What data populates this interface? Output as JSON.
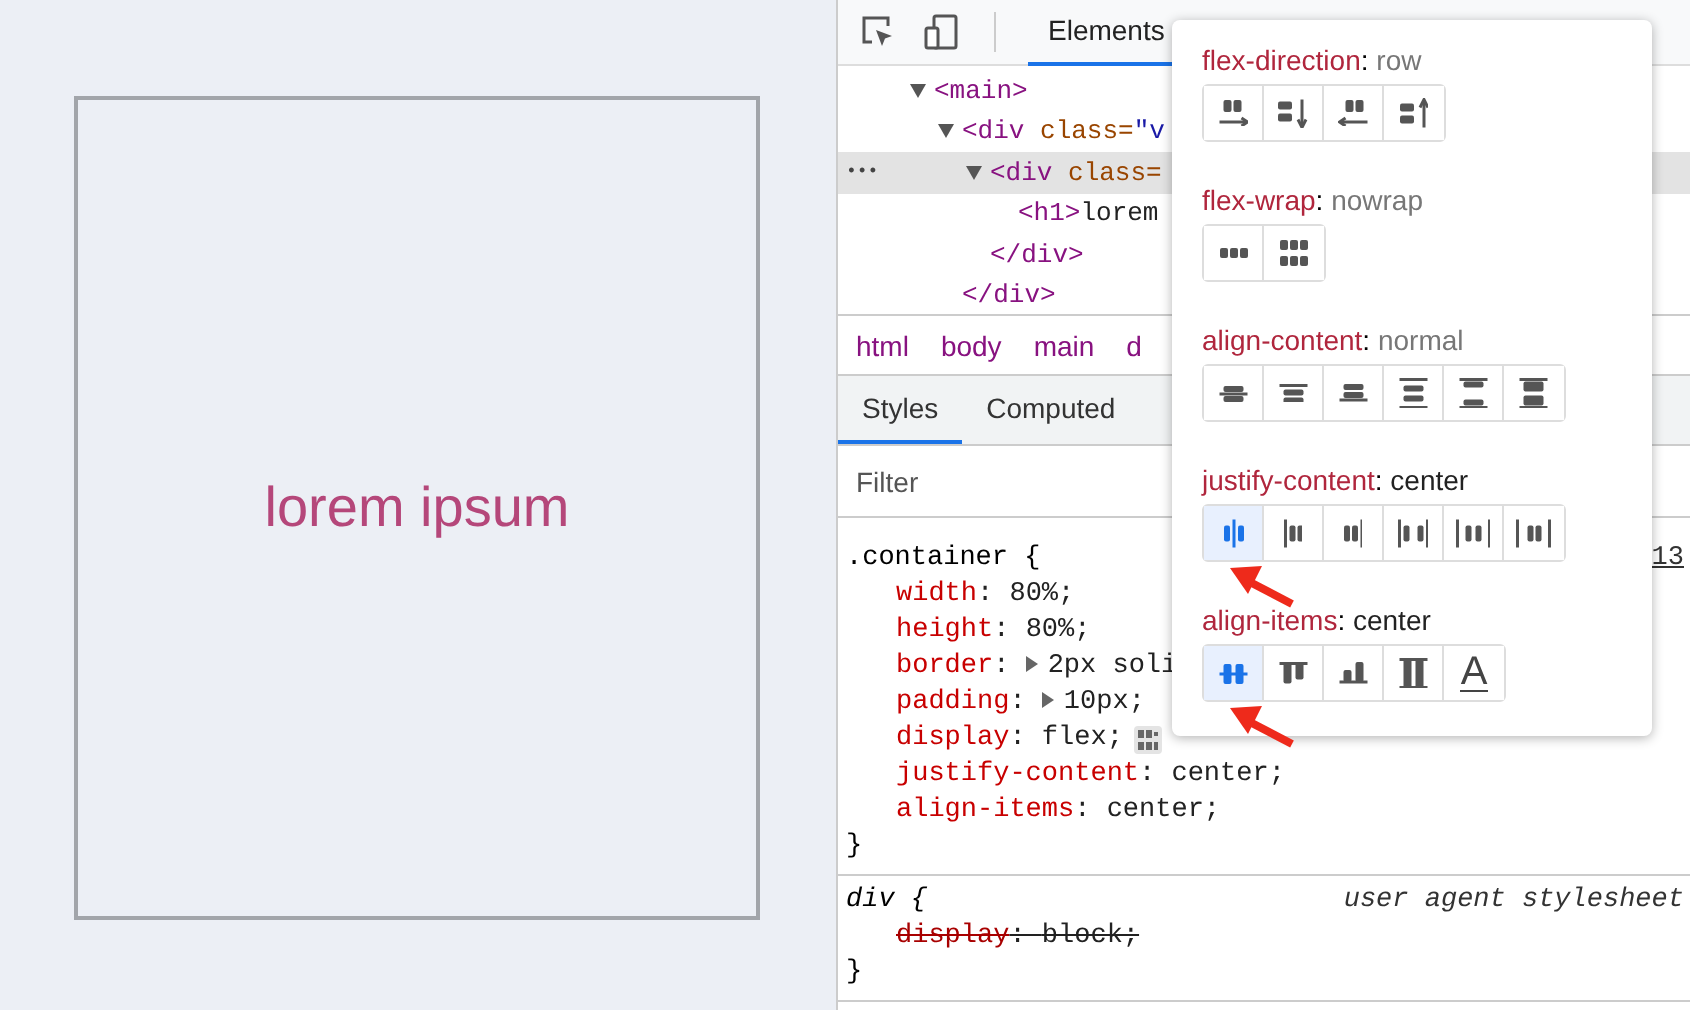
{
  "page": {
    "heading": "lorem ipsum"
  },
  "devtools": {
    "toolbar": {
      "tabs": [
        {
          "label": "Elements",
          "selected": true
        }
      ]
    },
    "elements_tree": [
      {
        "parts": [
          {
            "kind": "tag",
            "text": "<main>"
          }
        ],
        "expanded": true,
        "selected": false,
        "children": [
          {
            "parts": [
              {
                "kind": "tag",
                "text": "<div"
              },
              {
                "kind": "attr",
                "text": " class="
              },
              {
                "kind": "value",
                "text": "\"v"
              }
            ],
            "expanded": true,
            "selected": false,
            "closing": "</div>",
            "children": [
              {
                "parts": [
                  {
                    "kind": "tag",
                    "text": "<div"
                  },
                  {
                    "kind": "attr",
                    "text": " class="
                  }
                ],
                "expanded": true,
                "selected": true,
                "closing": "</div>",
                "children": [
                  {
                    "parts": [
                      {
                        "kind": "tag",
                        "text": "<h1>"
                      },
                      {
                        "kind": "text",
                        "text": "lorem"
                      }
                    ],
                    "selected": false
                  }
                ]
              }
            ]
          }
        ]
      }
    ],
    "selected_marker": "•••",
    "breadcrumbs": [
      "html",
      "body",
      "main",
      "d"
    ],
    "panel_tabs": [
      {
        "label": "Styles",
        "selected": true
      },
      {
        "label": "Computed",
        "selected": false
      }
    ],
    "filter": {
      "placeholder": "Filter"
    },
    "rules": [
      {
        "selector": ".container {",
        "source": "13",
        "italic": false,
        "declarations": [
          {
            "name": "width",
            "colon": ":",
            "value": "80%;",
            "expandable": false,
            "overridden": false,
            "flex_editor": false
          },
          {
            "name": "height",
            "colon": ":",
            "value": "80%;",
            "expandable": false,
            "overridden": false,
            "flex_editor": false
          },
          {
            "name": "border",
            "colon": ":",
            "value": "2px soli",
            "expandable": true,
            "overridden": false,
            "flex_editor": false
          },
          {
            "name": "padding",
            "colon": ":",
            "value": "10px;",
            "expandable": true,
            "overridden": false,
            "flex_editor": false
          },
          {
            "name": "display",
            "colon": ":",
            "value": "flex;",
            "expandable": false,
            "overridden": false,
            "flex_editor": true
          },
          {
            "name": "justify-content",
            "colon": ":",
            "value": "center;",
            "expandable": false,
            "overridden": false,
            "flex_editor": false
          },
          {
            "name": "align-items",
            "colon": ":",
            "value": "center;",
            "expandable": false,
            "overridden": false,
            "flex_editor": false
          }
        ],
        "closing": "}"
      },
      {
        "selector": "div {",
        "source": "user agent stylesheet",
        "italic": true,
        "declarations": [
          {
            "name": "display",
            "colon": ":",
            "value": "block;",
            "expandable": false,
            "overridden": true,
            "flex_editor": false
          }
        ],
        "closing": "}"
      }
    ],
    "flex_editor": [
      {
        "property": "flex-direction",
        "colon": ":",
        "value": "row",
        "explicit": false,
        "buttons": [
          {
            "selected": false
          },
          {
            "selected": false
          },
          {
            "selected": false
          },
          {
            "selected": false
          }
        ]
      },
      {
        "property": "flex-wrap",
        "colon": ":",
        "value": "nowrap",
        "explicit": false,
        "buttons": [
          {
            "selected": false
          },
          {
            "selected": false
          }
        ]
      },
      {
        "property": "align-content",
        "colon": ":",
        "value": "normal",
        "explicit": false,
        "buttons": [
          {
            "selected": false
          },
          {
            "selected": false
          },
          {
            "selected": false
          },
          {
            "selected": false
          },
          {
            "selected": false
          },
          {
            "selected": false
          }
        ]
      },
      {
        "property": "justify-content",
        "colon": ":",
        "value": "center",
        "explicit": true,
        "buttons": [
          {
            "selected": true
          },
          {
            "selected": false
          },
          {
            "selected": false
          },
          {
            "selected": false
          },
          {
            "selected": false
          },
          {
            "selected": false
          }
        ]
      },
      {
        "property": "align-items",
        "colon": ":",
        "value": "center",
        "explicit": true,
        "buttons": [
          {
            "selected": true
          },
          {
            "selected": false
          },
          {
            "selected": false
          },
          {
            "selected": false
          },
          {
            "selected": false,
            "label": "A"
          }
        ]
      }
    ]
  }
}
